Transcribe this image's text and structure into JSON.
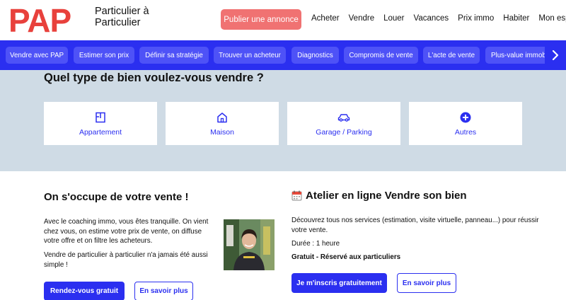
{
  "header": {
    "logo": "PAP",
    "tagline_line1": "Particulier à",
    "tagline_line2": "Particulier",
    "publish_label": "Publier une annonce",
    "nav": [
      "Acheter",
      "Vendre",
      "Louer",
      "Vacances",
      "Prix immo",
      "Habiter",
      "Mon espace"
    ]
  },
  "subnav": {
    "items": [
      "Vendre avec PAP",
      "Estimer son prix",
      "Définir sa stratégie",
      "Trouver un acheteur",
      "Diagnostics",
      "Compromis de vente",
      "L'acte de vente",
      "Plus-value immobilière"
    ],
    "next_icon": "chevron-right-icon"
  },
  "property": {
    "title": "Quel type de bien voulez-vous vendre ?",
    "types": [
      {
        "label": "Appartement",
        "icon": "apartment-icon"
      },
      {
        "label": "Maison",
        "icon": "house-icon"
      },
      {
        "label": "Garage / Parking",
        "icon": "car-icon"
      },
      {
        "label": "Autres",
        "icon": "plus-circle-icon"
      }
    ]
  },
  "coaching": {
    "title": "On s'occupe de votre vente !",
    "para1": "Avec le coaching immo, vous êtes tranquille. On vient chez vous, on estime votre prix de vente, on diffuse votre offre et on filtre les acheteurs.",
    "para2": "Vendre de particulier à particulier n'a jamais été aussi simple !",
    "primary_label": "Rendez-vous gratuit",
    "secondary_label": "En savoir plus"
  },
  "atelier": {
    "title": "Atelier en ligne Vendre son bien",
    "para1": "Découvrez tous nos services (estimation, visite virtuelle, panneau...) pour réussir votre vente.",
    "duration": "Durée : 1 heure",
    "price": "Gratuit - Réservé aux particuliers",
    "primary_label": "Je m'inscris gratuitement",
    "secondary_label": "En savoir plus"
  },
  "colors": {
    "brand_red": "#e8413c",
    "primary_blue": "#2b2ff0",
    "section_bg": "#cfdbe5"
  }
}
